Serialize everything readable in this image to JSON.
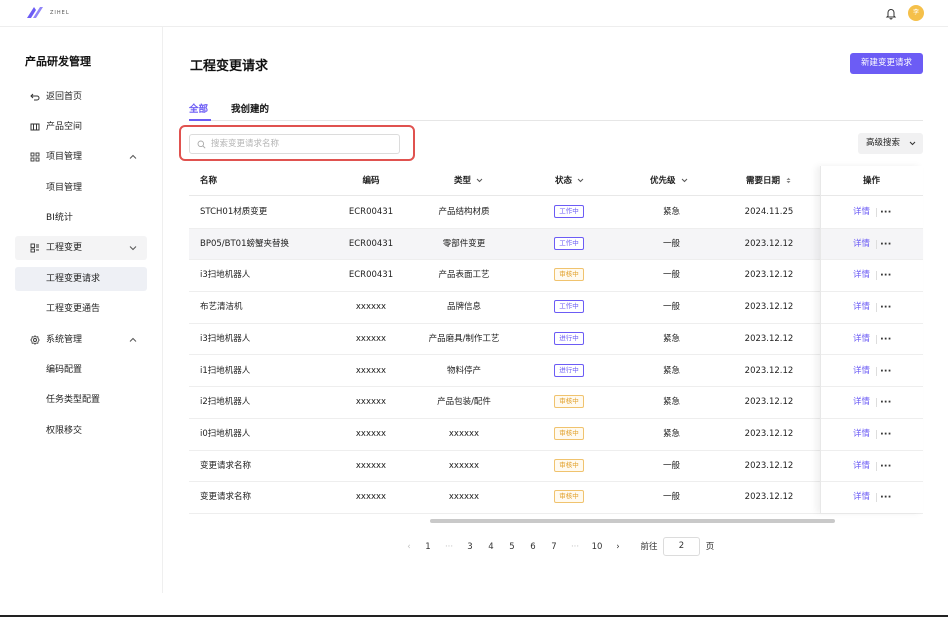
{
  "app": {
    "logo_text": "ZIHEL",
    "avatar_initials": "李"
  },
  "sidebar": {
    "title": "产品研发管理",
    "items": [
      {
        "label": "返回首页",
        "icon": "return-icon"
      },
      {
        "label": "产品空间",
        "icon": "product-space-icon"
      },
      {
        "label": "项目管理",
        "icon": "grid-icon",
        "expanded": true
      },
      {
        "label": "项目管理",
        "sub": true
      },
      {
        "label": "BI统计",
        "sub": true
      },
      {
        "label": "工程变更",
        "icon": "layout-icon",
        "expanded": true
      },
      {
        "label": "工程变更请求",
        "sub": true,
        "active": true
      },
      {
        "label": "工程变更通告",
        "sub": true
      },
      {
        "label": "系统管理",
        "icon": "gear-icon",
        "expanded": true
      },
      {
        "label": "编码配置",
        "sub": true
      },
      {
        "label": "任务类型配置",
        "sub": true
      },
      {
        "label": "权限移交",
        "sub": true
      }
    ]
  },
  "main": {
    "title": "工程变更请求",
    "new_button": "新建变更请求",
    "tabs": [
      "全部",
      "我创建的"
    ],
    "search_placeholder": "搜索变更请求名称",
    "advanced_search": "高级搜索"
  },
  "table": {
    "columns": [
      "名称",
      "编码",
      "类型",
      "状态",
      "优先级",
      "需要日期",
      "操作"
    ],
    "rows": [
      {
        "name": "STCH01材质变更",
        "code": "ECR00431",
        "type": "产品结构材质",
        "status": "工作中",
        "status_kind": "work",
        "priority": "紧急",
        "date": "2024.11.25"
      },
      {
        "name": "BP05/BT01螃蟹夹替换",
        "code": "ECR00431",
        "type": "零部件变更",
        "status": "工作中",
        "status_kind": "work",
        "priority": "一般",
        "date": "2023.12.12"
      },
      {
        "name": "i3扫地机器人",
        "code": "ECR00431",
        "type": "产品表面工艺",
        "status": "审核中",
        "status_kind": "review",
        "priority": "一般",
        "date": "2023.12.12"
      },
      {
        "name": "布艺清洁机",
        "code": "xxxxxx",
        "type": "品牌信息",
        "status": "工作中",
        "status_kind": "work",
        "priority": "一般",
        "date": "2023.12.12"
      },
      {
        "name": "i3扫地机器人",
        "code": "xxxxxx",
        "type": "产品磨具/制作工艺",
        "status": "进行中",
        "status_kind": "work",
        "priority": "紧急",
        "date": "2023.12.12"
      },
      {
        "name": "i1扫地机器人",
        "code": "xxxxxx",
        "type": "物料停产",
        "status": "进行中",
        "status_kind": "work",
        "priority": "紧急",
        "date": "2023.12.12"
      },
      {
        "name": "i2扫地机器人",
        "code": "xxxxxx",
        "type": "产品包装/配件",
        "status": "审核中",
        "status_kind": "review",
        "priority": "紧急",
        "date": "2023.12.12"
      },
      {
        "name": "i0扫地机器人",
        "code": "xxxxxx",
        "type": "xxxxxx",
        "status": "审核中",
        "status_kind": "review",
        "priority": "紧急",
        "date": "2023.12.12"
      },
      {
        "name": "变更请求名称",
        "code": "xxxxxx",
        "type": "xxxxxx",
        "status": "审核中",
        "status_kind": "review",
        "priority": "一般",
        "date": "2023.12.12"
      },
      {
        "name": "变更请求名称",
        "code": "xxxxxx",
        "type": "xxxxxx",
        "status": "审核中",
        "status_kind": "review",
        "priority": "一般",
        "date": "2023.12.12"
      }
    ],
    "op_detail": "详情",
    "op_more": "···"
  },
  "pagination": {
    "pages": [
      "1",
      "···",
      "3",
      "4",
      "5",
      "6",
      "7",
      "···",
      "10"
    ],
    "current": "1",
    "goto_label": "前往",
    "goto_value": "2",
    "page_suffix": "页"
  },
  "colors": {
    "accent": "#6c5cf5",
    "highlight": "#e0524f",
    "review": "#e2a12c"
  }
}
